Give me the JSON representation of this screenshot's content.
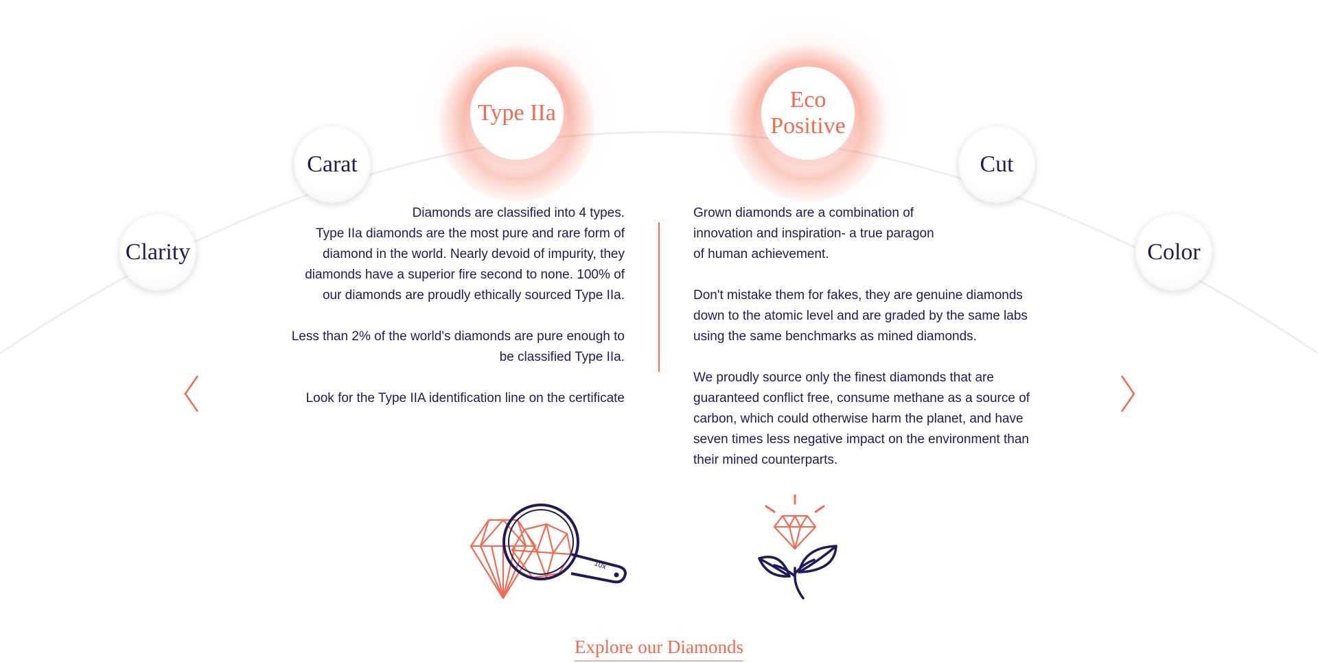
{
  "circles": {
    "clarity": "Clarity",
    "carat": "Carat",
    "type_iia": "Type IIa",
    "eco_positive_line1": "Eco",
    "eco_positive_line2": "Positive",
    "cut": "Cut",
    "color": "Color"
  },
  "left_panel": {
    "paragraph1": "Diamonds are classified into 4 types.\nType IIa diamonds are the most pure and rare form of\ndiamond in the world.  Nearly devoid of impurity, they\ndiamonds have a superior fire second to none. 100% of\nour diamonds are proudly ethically sourced Type IIa.",
    "paragraph2": "Less than 2% of the world's diamonds are pure enough to\nbe classified Type IIa.",
    "paragraph3": "Look for the Type IIA identification line on the certificate"
  },
  "right_panel": {
    "paragraph1": "Grown diamonds are a combination of\ninnovation and inspiration- a true paragon\nof human achievement.",
    "paragraph2": "Don't mistake them for fakes, they are genuine diamonds\ndown to the atomic level and are graded by the same labs\nusing the same benchmarks as mined diamonds.",
    "paragraph3": "We proudly source only the finest diamonds that are\nguaranteed conflict free, consume methane as a source of\ncarbon, which could otherwise harm the planet, and have\nseven times less negative impact on the environment than\ntheir mined counterparts."
  },
  "loupe_label": "10x",
  "explore_link": "Explore our Diamonds",
  "colors": {
    "accent": "#f26b4f",
    "navy": "#1e1a5c"
  },
  "icons": {
    "prev": "chevron-left-icon",
    "next": "chevron-right-icon",
    "loupe": "diamond-loupe-icon",
    "plant": "diamond-plant-icon"
  }
}
